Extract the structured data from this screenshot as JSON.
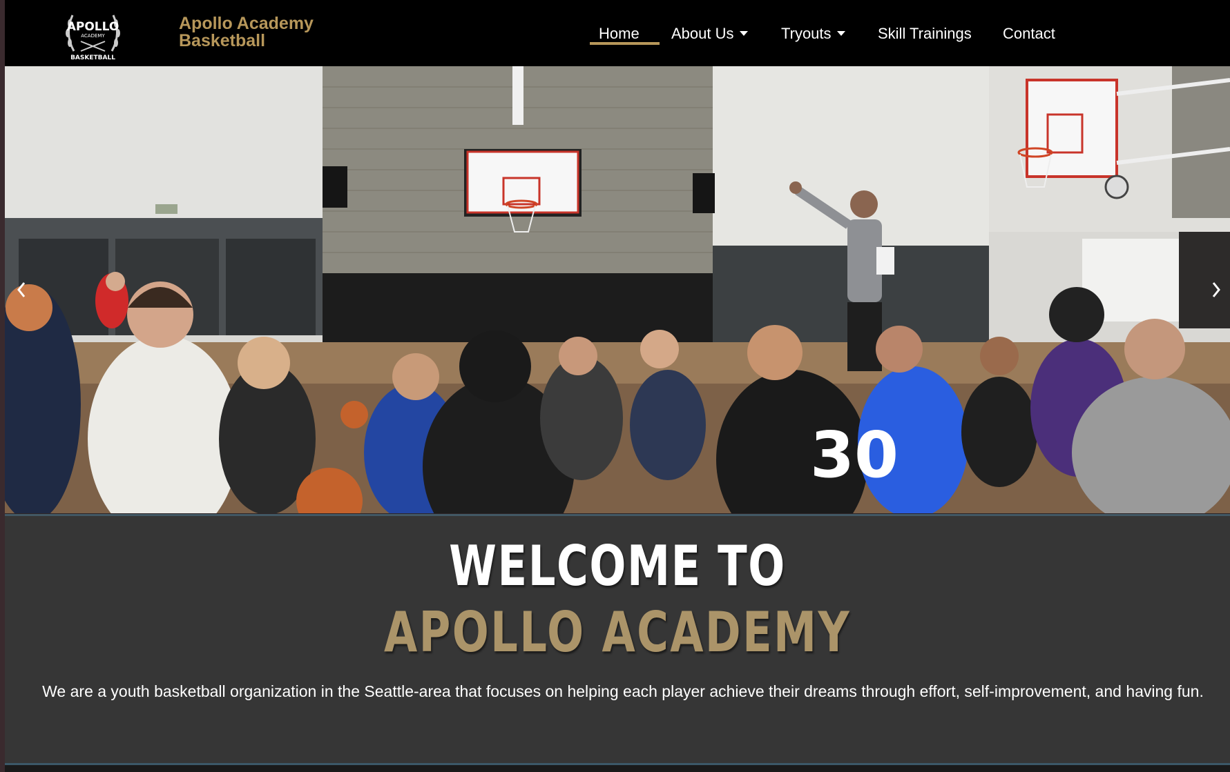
{
  "brand": {
    "line1": "Apollo Academy",
    "line2": "Basketball",
    "logo_text_top": "APOLLO",
    "logo_text_mid": "ACADEMY",
    "logo_text_bottom": "BASKETBALL"
  },
  "nav": {
    "home": "Home",
    "about": "About Us",
    "tryouts": "Tryouts",
    "skills": "Skill Trainings",
    "contact": "Contact"
  },
  "hero": {
    "prev_icon": "chevron-left-icon",
    "next_icon": "chevron-right-icon",
    "jersey_number": "30"
  },
  "welcome": {
    "line1": "WELCOME TO",
    "line2": "APOLLO ACADEMY",
    "description": "We are a youth basketball organization in the Seattle-area that focuses on helping each player achieve their dreams through effort, self-improvement, and having fun."
  },
  "colors": {
    "accent": "#b7975a",
    "heading_gold": "#ab9469",
    "header_bg": "#000000",
    "section_bg": "#363636"
  }
}
